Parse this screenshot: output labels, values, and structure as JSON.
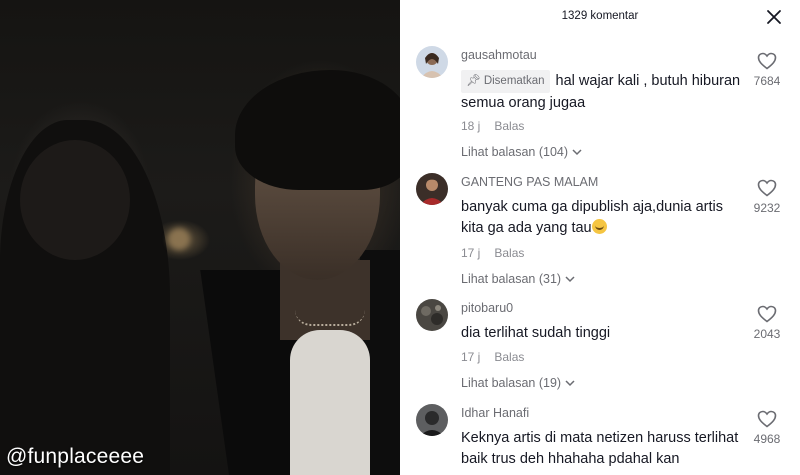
{
  "video": {
    "watermark": "@funplaceeee"
  },
  "panel": {
    "title": "1329 komentar",
    "close_icon": "close-icon"
  },
  "comments": [
    {
      "user": "gausahmotau",
      "pinned_label": "Disematkan",
      "text": "hal wajar kali , butuh hiburan semua orang jugaa",
      "time": "18 j",
      "reply_label": "Balas",
      "view_replies": "Lihat balasan (104)",
      "likes": "7684"
    },
    {
      "user": "GANTENG PAS MALAM",
      "text": "banyak cuma ga dipublish aja,dunia artis kita ga ada yang tau",
      "time": "17 j",
      "reply_label": "Balas",
      "view_replies": "Lihat balasan (31)",
      "likes": "9232"
    },
    {
      "user": "pitobaru0",
      "text": "dia terlihat sudah tinggi",
      "time": "17 j",
      "reply_label": "Balas",
      "view_replies": "Lihat balasan (19)",
      "likes": "2043"
    },
    {
      "user": "Idhar Hanafi",
      "text": "Keknya artis di mata netizen haruss terlihat baik trus deh hhahaha pdahal kan",
      "likes": "4968"
    }
  ],
  "colors": {
    "text_primary": "#161823",
    "text_secondary": "#6b6c72",
    "background": "#ffffff"
  }
}
